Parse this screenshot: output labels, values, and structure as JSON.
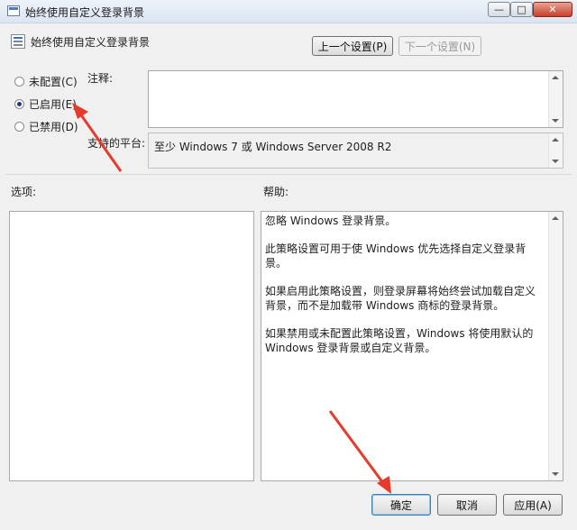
{
  "window": {
    "title": "始终使用自定义登录背景",
    "controls": {
      "minimize": "—",
      "maximize": "□",
      "close": "✕"
    }
  },
  "header": {
    "policy_title": "始终使用自定义登录背景",
    "prev_button": "上一个设置(P)",
    "next_button": "下一个设置(N)"
  },
  "options": [
    {
      "label": "未配置(C)",
      "checked": false
    },
    {
      "label": "已启用(E)",
      "checked": true
    },
    {
      "label": "已禁用(D)",
      "checked": false
    }
  ],
  "comment": {
    "label": "注释:",
    "value": ""
  },
  "platform": {
    "label": "支持的平台:",
    "value": "至少 Windows 7 或 Windows Server 2008 R2"
  },
  "options_pane": {
    "label": "选项:"
  },
  "help_pane": {
    "label": "帮助:",
    "paragraphs": [
      "忽略 Windows 登录背景。",
      "此策略设置可用于使 Windows 优先选择自定义登录背景。",
      "如果启用此策略设置，则登录屏幕将始终尝试加载自定义背景，而不是加载带 Windows 商标的登录背景。",
      "如果禁用或未配置此策略设置，Windows 将使用默认的 Windows 登录背景或自定义背景。"
    ]
  },
  "footer": {
    "ok": "确定",
    "cancel": "取消",
    "apply": "应用(A)"
  },
  "colors": {
    "annotation_arrow": "#e53a2c",
    "default_button_border": "#3c7fb1"
  }
}
